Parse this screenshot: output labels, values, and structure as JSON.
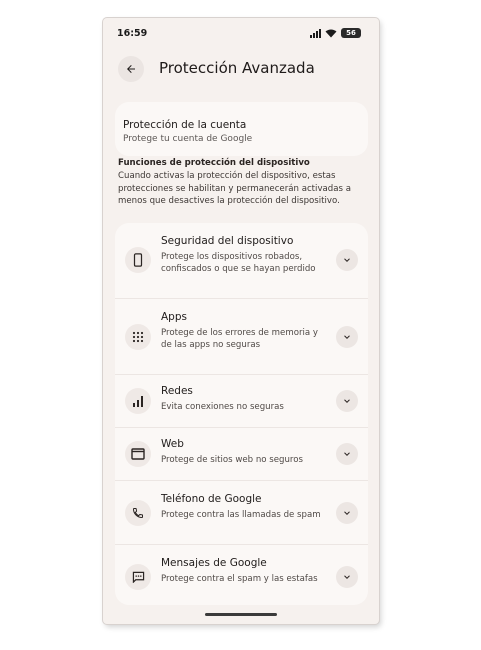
{
  "status_bar": {
    "time": "16:59",
    "battery": "56"
  },
  "header": {
    "title": "Protección Avanzada"
  },
  "account": {
    "title": "Protección de la cuenta",
    "subtitle": "Protege tu cuenta de Google"
  },
  "device_section": {
    "title": "Funciones de protección del dispositivo",
    "description": "Cuando activas la protección del dispositivo, estas protecciones se habilitan y permanecerán activadas a menos que desactives la protección del dispositivo."
  },
  "features": [
    {
      "icon": "phone-icon",
      "title": "Seguridad del dispositivo",
      "description": "Protege los dispositivos robados, confiscados o que se hayan perdido"
    },
    {
      "icon": "apps-grid-icon",
      "title": "Apps",
      "description": "Protege de los errores de memoria y de las apps no seguras"
    },
    {
      "icon": "signal-bars-icon",
      "title": "Redes",
      "description": "Evita conexiones no seguras"
    },
    {
      "icon": "browser-window-icon",
      "title": "Web",
      "description": "Protege de sitios web no seguros"
    },
    {
      "icon": "call-icon",
      "title": "Teléfono de Google",
      "description": "Protege contra las llamadas de spam"
    },
    {
      "icon": "message-icon",
      "title": "Mensajes de Google",
      "description": "Protege contra el spam y las estafas"
    }
  ]
}
